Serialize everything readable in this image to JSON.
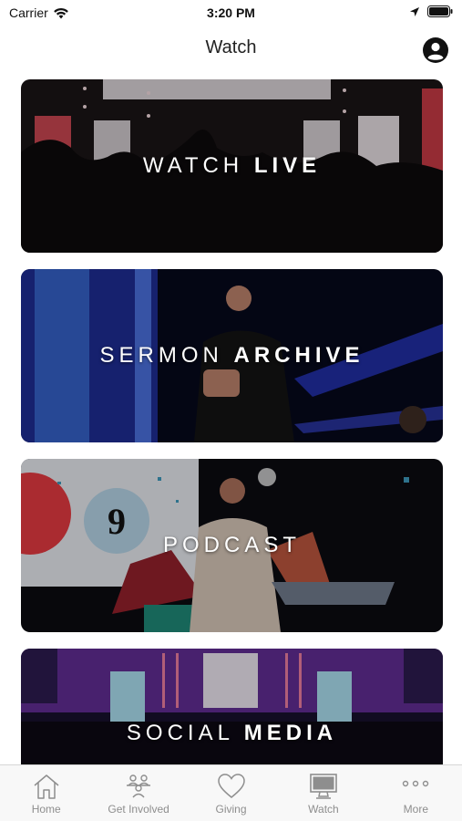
{
  "status_bar": {
    "carrier": "Carrier",
    "time": "3:20 PM"
  },
  "nav": {
    "title": "Watch"
  },
  "cards": [
    {
      "light": "WATCH",
      "bold": "LIVE"
    },
    {
      "light": "SERMON",
      "bold": "ARCHIVE"
    },
    {
      "light": "PODCAST",
      "bold": ""
    },
    {
      "light": "SOCIAL",
      "bold": "MEDIA"
    }
  ],
  "tabs": [
    {
      "label": "Home",
      "icon": "home-icon"
    },
    {
      "label": "Get Involved",
      "icon": "people-icon"
    },
    {
      "label": "Giving",
      "icon": "heart-icon"
    },
    {
      "label": "Watch",
      "icon": "monitor-icon"
    },
    {
      "label": "More",
      "icon": "more-icon"
    }
  ],
  "colors": {
    "tab_inactive": "#8e8e8e",
    "tab_bar_bg": "#f8f8f8"
  }
}
